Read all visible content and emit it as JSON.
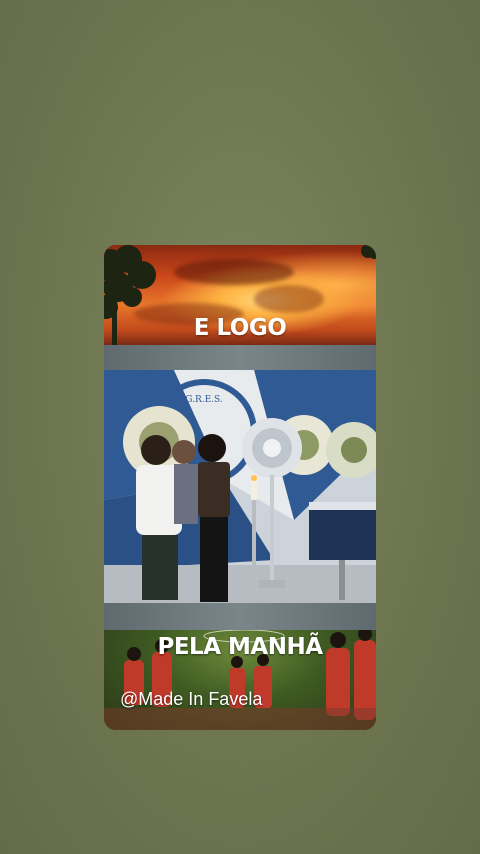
{
  "story": {
    "top_caption": "E LOGO",
    "bottom_caption": "PELA MANHÃ",
    "handle": "@Made In Favela"
  },
  "scene": {
    "banner_text": "G.R.E.S."
  },
  "colors": {
    "background": "#6f7852",
    "sunset_orange": "#e9772b",
    "banner_blue": "#2f5a93",
    "pitch_green": "#3e5a22"
  }
}
